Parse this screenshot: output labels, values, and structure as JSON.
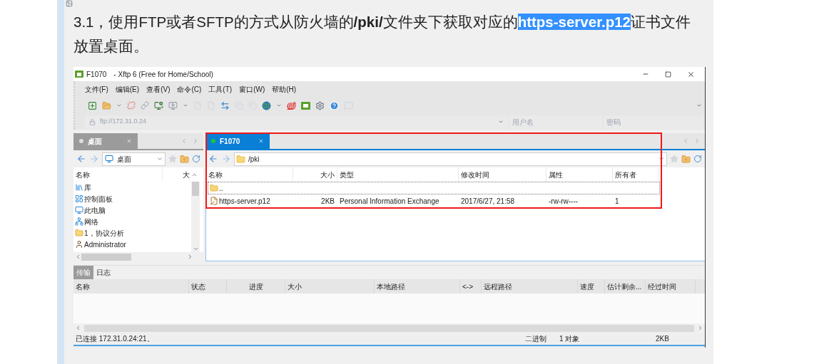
{
  "paragraph": {
    "parts": [
      {
        "text": "3.1，使用FTP或者SFTP的方式从防火墙的**/pki/**文件夹下获取对应的",
        "selected": false
      },
      {
        "text": "https-server.p12",
        "selected": true
      },
      {
        "text": "证书文件放置桌面。",
        "selected": false
      }
    ]
  },
  "window": {
    "title": "F1070",
    "subtitle": "- Xftp 6 (Free for Home/School)"
  },
  "menu": [
    "文件(F)",
    "编辑(E)",
    "查看(V)",
    "命令(C)",
    "工具(T)",
    "窗口(W)",
    "帮助(H)"
  ],
  "address": {
    "value": "ftp://172.31.0.24",
    "username_placeholder": "用户名",
    "password_placeholder": "密码"
  },
  "left_panel": {
    "tabs": [
      {
        "label": "桌面",
        "selected": false,
        "connected": false
      }
    ],
    "path": "桌面",
    "columns": [
      "名称",
      "大"
    ],
    "items": [
      {
        "kind": "library",
        "name": "库"
      },
      {
        "kind": "control-panel",
        "name": "控制面板"
      },
      {
        "kind": "computer",
        "name": "此电脑"
      },
      {
        "kind": "network",
        "name": "网络"
      },
      {
        "kind": "folder",
        "name": "1，协议分析"
      },
      {
        "kind": "user",
        "name": "Administrator"
      }
    ]
  },
  "right_panel": {
    "tabs": [
      {
        "label": "F1070",
        "selected": true,
        "connected": true
      }
    ],
    "path": "/pki",
    "columns": [
      "名称",
      "大小",
      "类型",
      "修改时间",
      "属性",
      "所有者"
    ],
    "rows": [
      {
        "kind": "parent",
        "focused": true,
        "cells": [
          ".."
        ]
      },
      {
        "kind": "file",
        "focused": false,
        "cells": [
          "https-server.p12",
          "2KB",
          "Personal Information Exchange",
          "2017/6/27, 21:58",
          "-rw-rw----",
          "1"
        ]
      }
    ]
  },
  "transfer": {
    "tabs": [
      {
        "label": "传输",
        "selected": true
      },
      {
        "label": "日志",
        "selected": false
      }
    ],
    "columns": [
      "名称",
      "状态",
      "进度",
      "大小",
      "本地路径",
      "<->",
      "远程路径",
      "速度",
      "估计剩余...",
      "经过时间"
    ]
  },
  "status_bar": {
    "connection": "已连接 172.31.0.24:21。",
    "mode": "二进制",
    "objects": "1 对象",
    "size": "2KB"
  }
}
